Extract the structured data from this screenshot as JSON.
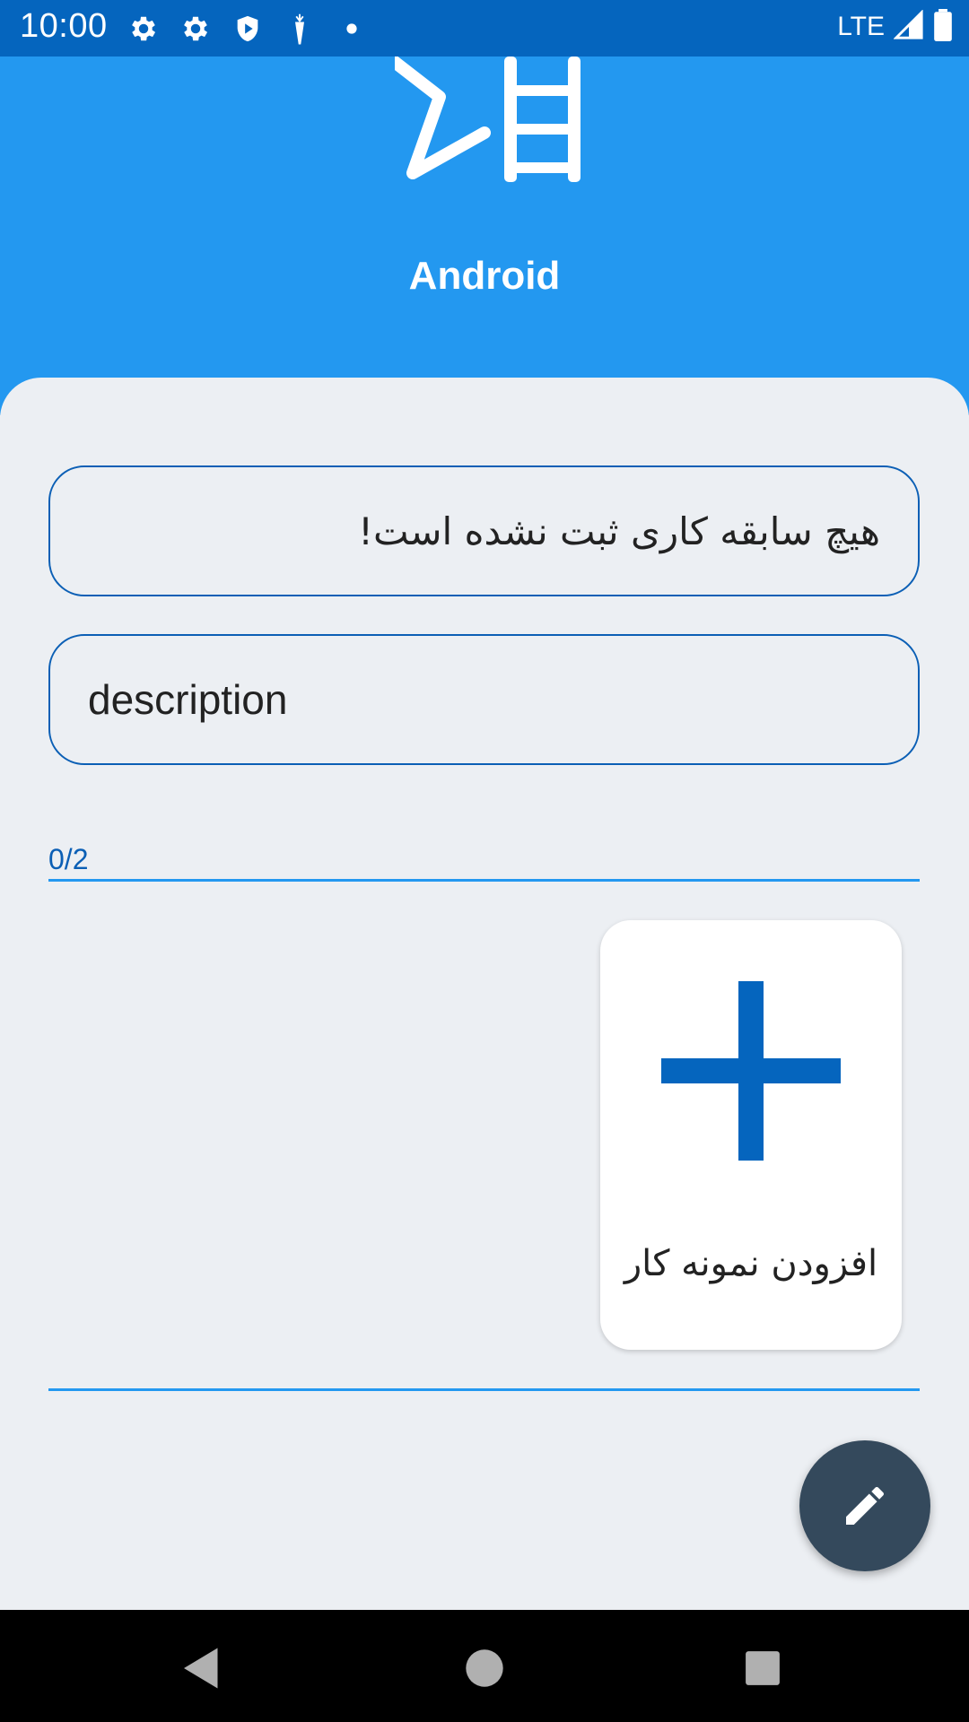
{
  "status_bar": {
    "time": "10:00",
    "network": "LTE",
    "icons": [
      "settings-icon",
      "settings-icon",
      "shield-icon",
      "carrot-icon",
      "dot-icon",
      "signal-icon",
      "battery-icon"
    ]
  },
  "header": {
    "app_name": "Android",
    "logo_icon": "app-logo-icon",
    "background": "#2398f0"
  },
  "form": {
    "history_field_text": "هیچ سابقه کاری ثبت نشده است!",
    "description_field_text": "description",
    "portfolio_counter": "0/2"
  },
  "portfolio": {
    "add_card_label": "افزودن نمونه کار",
    "add_icon": "plus-icon"
  },
  "fab": {
    "icon": "pencil-icon",
    "background": "#34495c"
  },
  "nav_bar": {
    "buttons": [
      "back-icon",
      "home-icon",
      "recent-apps-icon"
    ]
  },
  "colors": {
    "status_bar": "#0565be",
    "accent": "#0b5fb5",
    "sheet": "#eceff3"
  }
}
